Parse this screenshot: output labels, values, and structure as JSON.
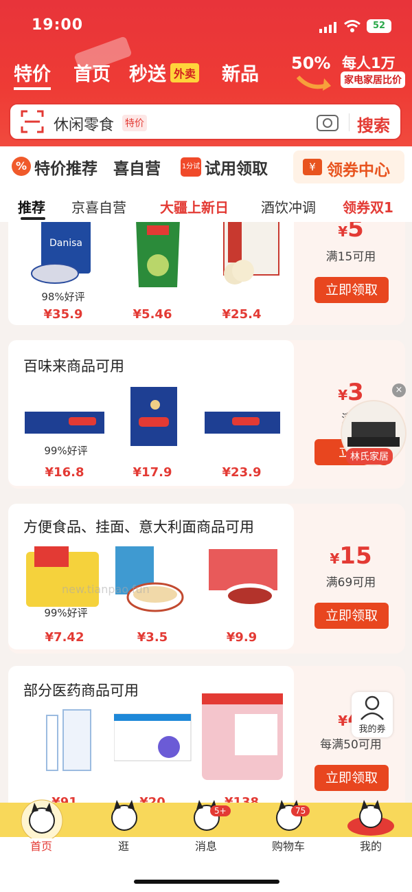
{
  "status": {
    "time": "19:00",
    "battery": "52"
  },
  "nav": {
    "tabs": [
      "特价",
      "首页",
      "秒送",
      "新品"
    ],
    "waimai_badge": "外卖",
    "promo_percent": "50%",
    "promo_title": "每人1万",
    "promo_sub": "家电家居比价"
  },
  "search": {
    "placeholder": "休闲零食",
    "tag": "特价",
    "button": "搜索"
  },
  "quick": {
    "special": "特价推荐",
    "self": "喜自营",
    "trial_icon": "1分试",
    "trial": "试用领取",
    "coupon_center": "领券中心"
  },
  "categories": [
    "推荐",
    "京喜自营",
    "大疆上新日",
    "酒饮冲调",
    "领券双1"
  ],
  "cards": [
    {
      "title": "",
      "amount": "5",
      "currency": "¥",
      "condition": "满15可用",
      "button": "立即领取",
      "products": [
        {
          "rating": "98%好评",
          "price": "¥35.9"
        },
        {
          "rating": "",
          "price": "¥5.46"
        },
        {
          "rating": "",
          "price": "¥25.4"
        }
      ]
    },
    {
      "title": "百味来商品可用",
      "amount": "3",
      "currency": "¥",
      "condition": "满1",
      "button": "立即",
      "products": [
        {
          "rating": "99%好评",
          "price": "¥16.8"
        },
        {
          "rating": "",
          "price": "¥17.9"
        },
        {
          "rating": "",
          "price": "¥23.9"
        }
      ]
    },
    {
      "title": "方便食品、挂面、意大利面商品可用",
      "amount": "15",
      "currency": "¥",
      "condition": "满69可用",
      "button": "立即领取",
      "products": [
        {
          "rating": "99%好评",
          "price": "¥7.42"
        },
        {
          "rating": "",
          "price": "¥3.5"
        },
        {
          "rating": "",
          "price": "¥9.9"
        }
      ]
    },
    {
      "title": "部分医药商品可用",
      "amount": "4",
      "currency": "¥",
      "condition": "每满50可用",
      "button": "立即领取",
      "products": [
        {
          "rating": "",
          "price": "¥91"
        },
        {
          "rating": "",
          "price": "¥20"
        },
        {
          "rating": "",
          "price": "¥138"
        }
      ]
    }
  ],
  "watermark": "new.tianpao.fun",
  "floats": {
    "ad_label": "林氏家居",
    "mine_label": "我的券"
  },
  "bottom": {
    "tabs": [
      "首页",
      "逛",
      "消息",
      "购物车",
      "我的"
    ],
    "msg_badge": "5+",
    "cart_badge": "75"
  }
}
